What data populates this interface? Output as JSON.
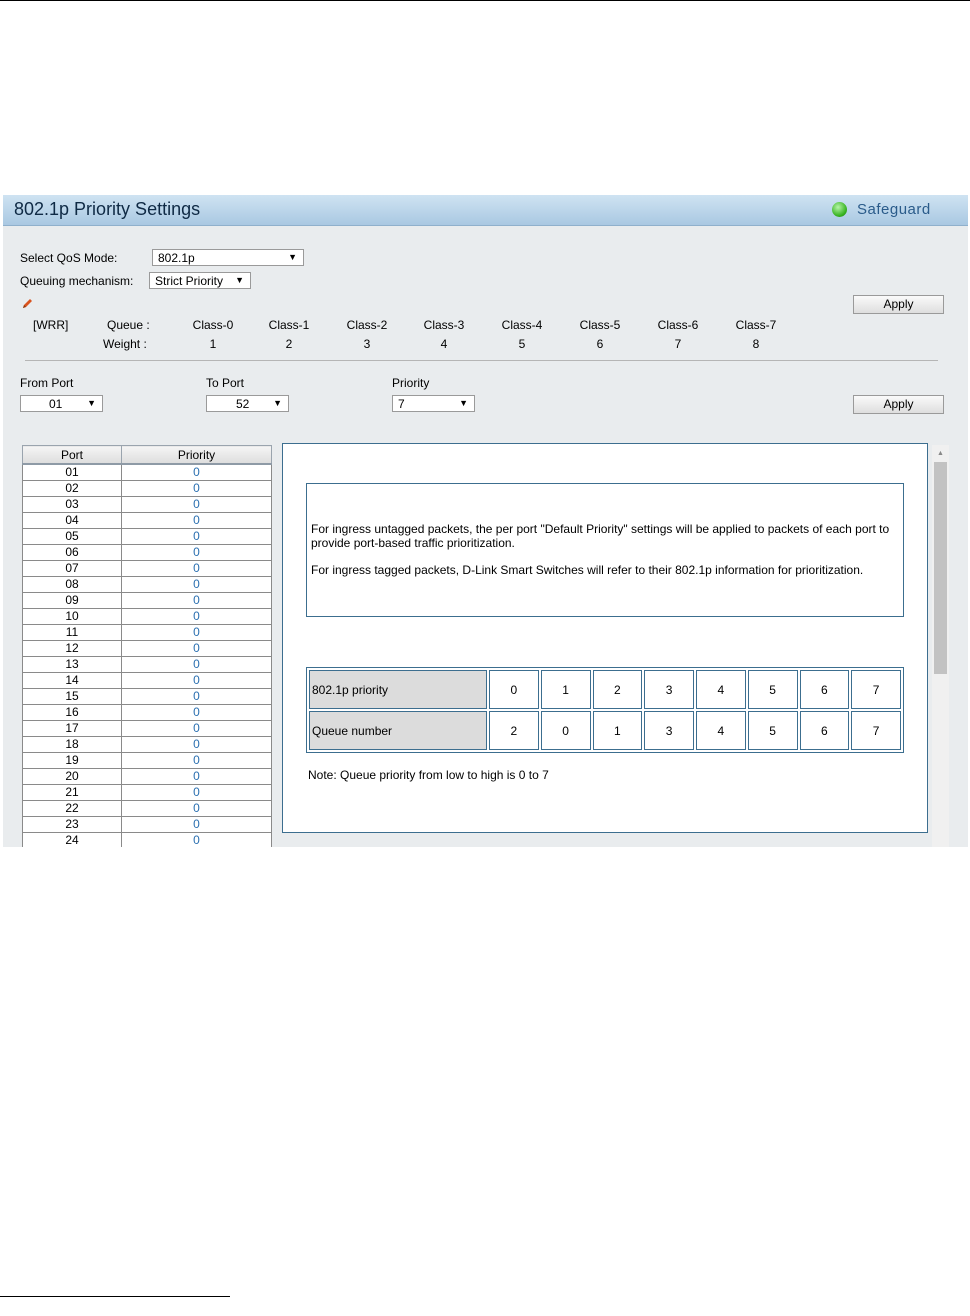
{
  "panel": {
    "title": "802.1p Priority Settings",
    "safeguard": "Safeguard"
  },
  "qos": {
    "mode_label": "Select QoS Mode:",
    "mode_value": "802.1p",
    "queuing_label": "Queuing mechanism:",
    "queuing_value": "Strict Priority",
    "apply_label": "Apply",
    "wrr": "[WRR]",
    "queue_label": "Queue :",
    "weight_label": "Weight  :",
    "classes": [
      "Class-0",
      "Class-1",
      "Class-2",
      "Class-3",
      "Class-4",
      "Class-5",
      "Class-6",
      "Class-7"
    ],
    "weights": [
      "1",
      "2",
      "3",
      "4",
      "5",
      "6",
      "7",
      "8"
    ]
  },
  "port_form": {
    "from_label": "From Port",
    "from_value": "01",
    "to_label": "To Port",
    "to_value": "52",
    "priority_label": "Priority",
    "priority_value": "7",
    "apply_label": "Apply"
  },
  "port_table": {
    "headers": [
      "Port",
      "Priority"
    ],
    "rows": [
      [
        "01",
        "0"
      ],
      [
        "02",
        "0"
      ],
      [
        "03",
        "0"
      ],
      [
        "04",
        "0"
      ],
      [
        "05",
        "0"
      ],
      [
        "06",
        "0"
      ],
      [
        "07",
        "0"
      ],
      [
        "08",
        "0"
      ],
      [
        "09",
        "0"
      ],
      [
        "10",
        "0"
      ],
      [
        "11",
        "0"
      ],
      [
        "12",
        "0"
      ],
      [
        "13",
        "0"
      ],
      [
        "14",
        "0"
      ],
      [
        "15",
        "0"
      ],
      [
        "16",
        "0"
      ],
      [
        "17",
        "0"
      ],
      [
        "18",
        "0"
      ],
      [
        "19",
        "0"
      ],
      [
        "20",
        "0"
      ],
      [
        "21",
        "0"
      ],
      [
        "22",
        "0"
      ],
      [
        "23",
        "0"
      ],
      [
        "24",
        "0"
      ]
    ]
  },
  "info": {
    "p1": "For ingress untagged packets, the per port \"Default Priority\" settings will be applied to packets of each port to provide port-based traffic prioritization.",
    "p2": "For ingress tagged packets, D-Link Smart Switches will refer to their 802.1p information for prioritization.",
    "row1_label": "802.1p priority",
    "row1_values": [
      "0",
      "1",
      "2",
      "3",
      "4",
      "5",
      "6",
      "7"
    ],
    "row2_label": "Queue number",
    "row2_values": [
      "2",
      "0",
      "1",
      "3",
      "4",
      "5",
      "6",
      "7"
    ],
    "note": "Note: Queue priority from low to high is 0 to 7"
  }
}
